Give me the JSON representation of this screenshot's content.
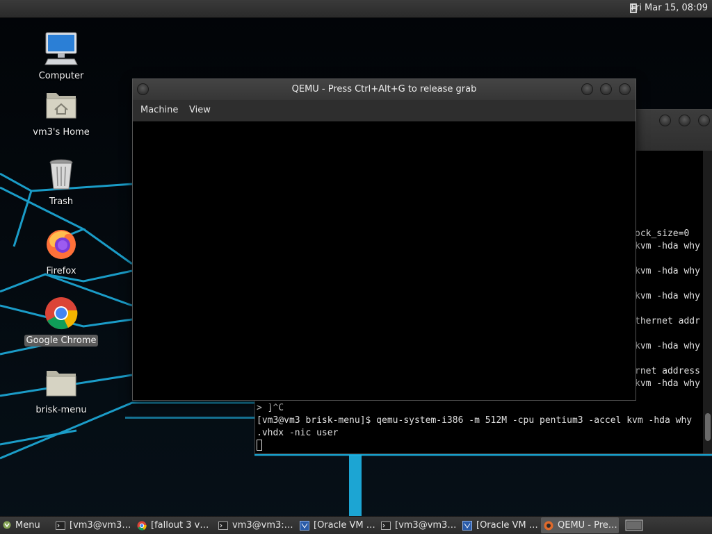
{
  "top_panel": {
    "clock": "Fri Mar 15, 08:09"
  },
  "desktop": {
    "icons": [
      {
        "label": "Computer",
        "icon": "computer-icon"
      },
      {
        "label": "vm3's Home",
        "icon": "home-folder-icon"
      },
      {
        "label": "Trash",
        "icon": "trash-icon"
      },
      {
        "label": "Firefox",
        "icon": "firefox-icon"
      },
      {
        "label": "Google Chrome",
        "icon": "chrome-icon",
        "selected": true
      },
      {
        "label": "brisk-menu",
        "icon": "folder-icon"
      }
    ]
  },
  "qemu_window": {
    "title": "QEMU - Press Ctrl+Alt+G to release grab",
    "menu": [
      "Machine",
      "View"
    ]
  },
  "terminal": {
    "partial_lines": [
      "ock_size=0",
      "kvm -hda why",
      "kvm -hda why",
      "kvm -hda why",
      "thernet addr",
      "kvm -hda why",
      "rnet address",
      "kvm -hda why"
    ],
    "lines": [
      "> ]^C",
      "[vm3@vm3 brisk-menu]$ qemu-system-i386 -m 512M -cpu pentium3 -accel kvm -hda why",
      ".vhdx -nic user"
    ]
  },
  "taskbar": {
    "menu_label": "Menu",
    "tasks": [
      {
        "label": "[vm3@vm3…",
        "icon": "terminal-icon"
      },
      {
        "label": "[fallout 3 v…",
        "icon": "chrome-icon"
      },
      {
        "label": "vm3@vm3:…",
        "icon": "terminal-icon"
      },
      {
        "label": "[Oracle VM …",
        "icon": "virtualbox-icon"
      },
      {
        "label": "[vm3@vm3…",
        "icon": "terminal-icon"
      },
      {
        "label": "[Oracle VM …",
        "icon": "virtualbox-icon"
      },
      {
        "label": "QEMU - Pre…",
        "icon": "qemu-icon",
        "active": true
      }
    ]
  },
  "colors": {
    "wallpaper_accent": "#1fb6e8",
    "panel": "#333333",
    "active_task": "#5a5a5a"
  }
}
